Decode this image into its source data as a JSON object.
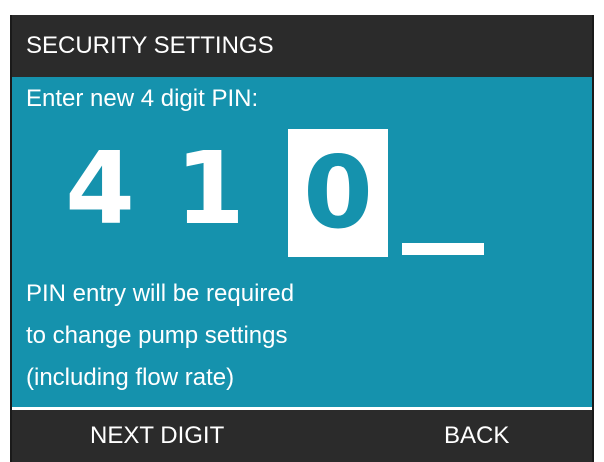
{
  "screen": {
    "title": "SECURITY SETTINGS",
    "prompt": "Enter new 4 digit PIN:",
    "pin": {
      "digits": [
        "4",
        "1",
        "0",
        "_"
      ],
      "active_index": 2
    },
    "info_lines": [
      "PIN entry will be required",
      "to change pump settings",
      "(including flow rate)"
    ]
  },
  "softkeys": {
    "left_label": "NEXT DIGIT",
    "right_label": "BACK"
  },
  "colors": {
    "panel_bg": "#1592ad",
    "bar_bg": "#2b2b2b",
    "text": "#ffffff"
  }
}
